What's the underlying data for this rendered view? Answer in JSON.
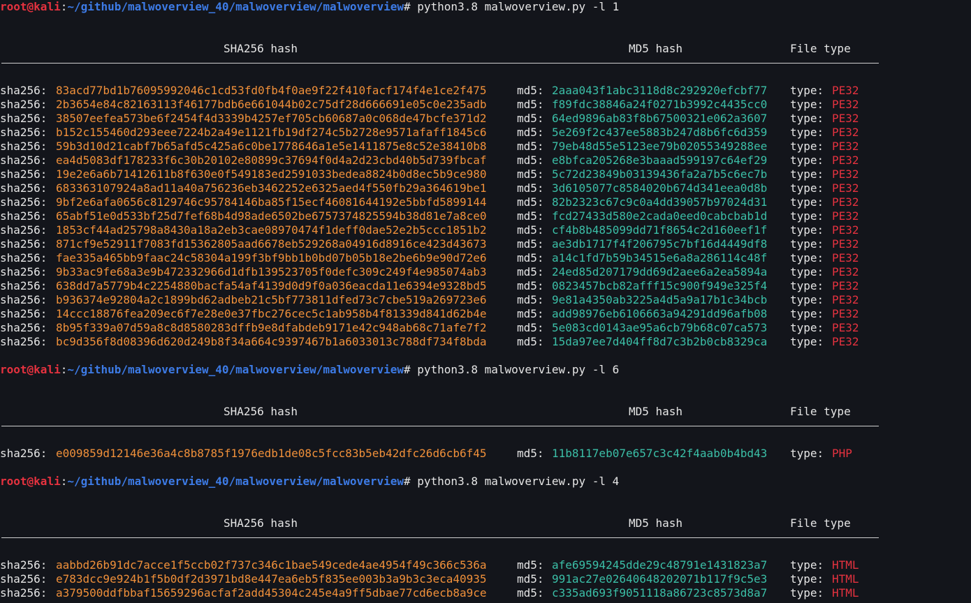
{
  "prompt": {
    "user": "root",
    "at": "@",
    "host": "kali",
    "colon": ":",
    "path": "~/github/malwoverview_40/malwoverview/malwoverview",
    "symbol": "#"
  },
  "headers": {
    "sha256": "SHA256 hash",
    "md5": "MD5 hash",
    "filetype": "File type"
  },
  "labels": {
    "sha": "sha256:",
    "md5": "md5:",
    "type": "type:"
  },
  "colors": {
    "background": "#13151b",
    "prompt_user": "#e5323f",
    "prompt_path": "#3d7be6",
    "sha256_value": "#f0903a",
    "md5_value": "#3bbfa7",
    "filetype_value": "#e5323f"
  },
  "sessions": [
    {
      "command": "python3.8 malwoverview.py -l 1",
      "rows": [
        {
          "sha256": "83acd77bd1b76095992046c1cd53fd0fb4f0ae9f22f410facf174f4e1ce2f475",
          "md5": "2aaa043f1abc3118d8c292920efcbf77",
          "type": "PE32"
        },
        {
          "sha256": "2b3654e84c82163113f46177bdb6e661044b02c75df28d666691e05c0e235adb",
          "md5": "f89fdc38846a24f0271b3992c4435cc0",
          "type": "PE32"
        },
        {
          "sha256": "38507eefea573be6f2454f4d3339b4257ef705cb60687a0c068de47bcfe371d2",
          "md5": "64ed9896ab83f8b67500321e062a3607",
          "type": "PE32"
        },
        {
          "sha256": "b152c155460d293eee7224b2a49e1121fb19df274c5b2728e9571afaff1845c6",
          "md5": "5e269f2c437ee5883b247d8b6fc6d359",
          "type": "PE32"
        },
        {
          "sha256": "59b3d10d21cabf7b65afd5c425a6c0be1778646a1e5e1411875e8c52e38410b8",
          "md5": "79eb48d55e5123ee79b02055349288ee",
          "type": "PE32"
        },
        {
          "sha256": "ea4d5083df178233f6c30b20102e80899c37694f0d4a2d23cbd40b5d739fbcaf",
          "md5": "e8bfca205268e3baaad599197c64ef29",
          "type": "PE32"
        },
        {
          "sha256": "19e2e6a6b71412611b8f630e0f549183ed2591033bedea8824b0d8ec5b9ce980",
          "md5": "5c72d23849b03139436fa2a7b5c6ec7b",
          "type": "PE32"
        },
        {
          "sha256": "68336310 7924a8ad11a40a756236eb3462252e6325aed4f550fb29a364619be1",
          "md5": "3d6105077c8584020b674d341eea0d8b",
          "type": "PE32"
        },
        {
          "sha256": "9bf2e6afa0656c8129746c95784146ba85f15ecf46081644192e5bbfd5899144",
          "md5": "82b2323c67c9c0a4dd39057b97024d31",
          "type": "PE32"
        },
        {
          "sha256": "65abf51e0d533bf25d7fef68b4d98ade6502be6757374825594b38d81e7a8ce0",
          "md5": "fcd27433d580e2cada0eed0cabcbab1d",
          "type": "PE32"
        },
        {
          "sha256": "1853cf44ad25798a8430a18a2eb3cae08970474f1deff0dae52e2b5ccc1851b2",
          "md5": "cf4b8b485099dd71f8654c2d160eef1f",
          "type": "PE32"
        },
        {
          "sha256": "871cf9e52911f7083fd15362805aad6678eb529268a04916d8916ce423d43673",
          "md5": "ae3db1717f4f206795c7bf16d4449df8",
          "type": "PE32"
        },
        {
          "sha256": "fae335a465bb9faac24c58304a199f3bf9bb1b0bd07b05b18e2be6b9e90d72e6",
          "md5": "a14c1fd7b59b34515e6a8a286114c48f",
          "type": "PE32"
        },
        {
          "sha256": "9b33ac9fe68a3e9b472332966d1dfb139523705f0defc309c249f4e985074ab3",
          "md5": "24ed85d207179dd69d2aee6a2ea5894a",
          "type": "PE32"
        },
        {
          "sha256": "638dd7a5779b4c2254880bacfa54af4139d0d9f0a036eacda11e6394e9328bd5",
          "md5": "0823457bcb82afff15c900f949e325f4",
          "type": "PE32"
        },
        {
          "sha256": "b936374e92804a2c1899bd62adbeb21c5bf773811dfed73c7cbe519a269723e6",
          "md5": "9e81a4350ab3225a4d5a9a17b1c34bcb",
          "type": "PE32"
        },
        {
          "sha256": "14ccc18876fea209ec6f7e28e0e37fbc276cec5c1ab958b4f81339d841d62b4e",
          "md5": "add98976eb6106663a94291dd96afb08",
          "type": "PE32"
        },
        {
          "sha256": "8b95f339a07d59a8c8d8580283dffb9e8dfabdeb9171e42c948ab68c71afe7f2",
          "md5": "5e083cd0143ae95a6cb79b68c07ca573",
          "type": "PE32"
        },
        {
          "sha256": "bc9d356f8d08396d620d249b8f34a664c9397467b1a6033013c788df734f8bda",
          "md5": "15da97ee7d404ff8d7c3b2b0cb8329ca",
          "type": "PE32"
        }
      ]
    },
    {
      "command": "python3.8 malwoverview.py -l 6",
      "rows": [
        {
          "sha256": "e009859d12146e36a4c8b8785f1976edb1de08c5fcc83b5eb42dfc26d6cb6f45",
          "md5": "11b8117eb07e657c3c42f4aab0b4bd43",
          "type": "PHP"
        }
      ]
    },
    {
      "command": "python3.8 malwoverview.py -l 4",
      "rows": [
        {
          "sha256": "aabbd26b91dc7acce1f5ccb02f737c346c1bae549cede4ae4954f49c366c536a",
          "md5": "afe69594245dde29c48791e1431823a7",
          "type": "HTML"
        },
        {
          "sha256": "e783dcc9e924b1f5b0df2d3971bd8e447ea6eb5f835ee003b3a9b3c3eca40935",
          "md5": "991ac27e02640648202071b117f9c5e3",
          "type": "HTML"
        },
        {
          "sha256": "a379500ddfbbaf15659296acfaf2add45304c245e4a9ff5dbae77cd6ecb8a9ce",
          "md5": "c335ad693f9051118a86723c8573d8a7",
          "type": "HTML"
        }
      ]
    }
  ]
}
